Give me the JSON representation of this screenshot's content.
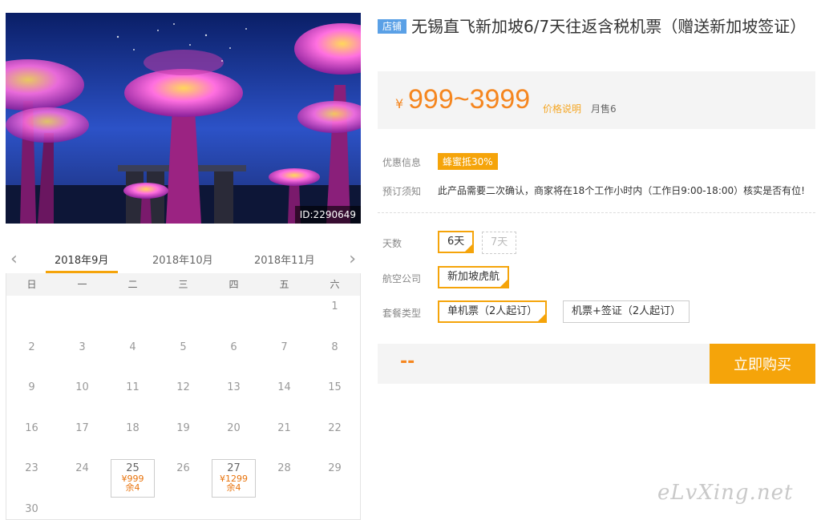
{
  "product": {
    "image_id": "ID:2290649",
    "shop_tag": "店铺",
    "title": "无锡直飞新加坡6/7天往返含税机票（赠送新加坡签证）"
  },
  "price": {
    "currency": "¥",
    "range": "999~3999",
    "note_link": "价格说明",
    "monthly_sales": "月售6"
  },
  "info": {
    "promo_label": "优惠信息",
    "promo_badge": "蜂蜜抵30%",
    "notice_label": "预订须知",
    "notice_text": "此产品需要二次确认，商家将在18个工作小时内（工作日9:00-18:00）核实是否有位!"
  },
  "options": {
    "days_label": "天数",
    "days": [
      {
        "label": "6天",
        "state": "selected"
      },
      {
        "label": "7天",
        "state": "disabled"
      }
    ],
    "airline_label": "航空公司",
    "airlines": [
      {
        "label": "新加坡虎航",
        "state": "selected"
      }
    ],
    "package_label": "套餐类型",
    "packages": [
      {
        "label": "单机票（2人起订）",
        "state": "selected"
      },
      {
        "label": "机票+签证（2人起订）",
        "state": "normal"
      }
    ]
  },
  "purchase": {
    "total": "--",
    "buy_label": "立即购买"
  },
  "calendar": {
    "months": [
      "2018年9月",
      "2018年10月",
      "2018年11月"
    ],
    "active_month": 0,
    "prev_icon": "‹",
    "next_icon": "›",
    "weekdays": [
      "日",
      "一",
      "二",
      "三",
      "四",
      "五",
      "六"
    ],
    "first_weekday": 6,
    "days_in_month": 30,
    "available": {
      "25": {
        "price": "¥999",
        "stock": "余4"
      },
      "27": {
        "price": "¥1299",
        "stock": "余4"
      }
    }
  },
  "watermark": "eLvXing.net",
  "colors": {
    "accent": "#f5a40a",
    "price": "#f5861f",
    "shop_tag": "#5aa0e6"
  }
}
